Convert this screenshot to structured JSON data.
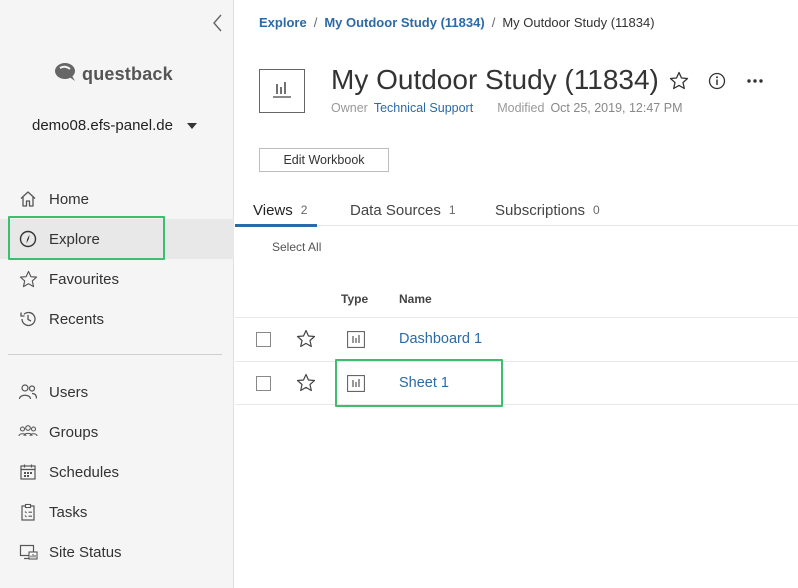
{
  "sidebar": {
    "logo_text": "questback",
    "site_name": "demo08.efs-panel.de",
    "nav_primary": [
      {
        "label": "Home",
        "icon": "home-icon"
      },
      {
        "label": "Explore",
        "icon": "compass-icon",
        "active": true
      },
      {
        "label": "Favourites",
        "icon": "star-icon"
      },
      {
        "label": "Recents",
        "icon": "history-icon"
      }
    ],
    "nav_admin": [
      {
        "label": "Users",
        "icon": "users-icon"
      },
      {
        "label": "Groups",
        "icon": "groups-icon"
      },
      {
        "label": "Schedules",
        "icon": "calendar-icon"
      },
      {
        "label": "Tasks",
        "icon": "clipboard-icon"
      },
      {
        "label": "Site Status",
        "icon": "site-status-icon"
      }
    ]
  },
  "breadcrumb": {
    "root": "Explore",
    "project": "My Outdoor Study (11834)",
    "current": "My Outdoor Study (11834)",
    "separator": "/"
  },
  "workbook": {
    "title": "My Outdoor Study (11834)",
    "owner_label": "Owner",
    "owner": "Technical Support",
    "modified_label": "Modified",
    "modified": "Oct 25, 2019, 12:47 PM",
    "edit_button": "Edit Workbook"
  },
  "tabs": [
    {
      "label": "Views",
      "count": "2",
      "active": true
    },
    {
      "label": "Data Sources",
      "count": "1"
    },
    {
      "label": "Subscriptions",
      "count": "0"
    }
  ],
  "table": {
    "select_all": "Select All",
    "col_type": "Type",
    "col_name": "Name",
    "rows": [
      {
        "name": "Dashboard 1",
        "type_icon": "bar-chart-icon"
      },
      {
        "name": "Sheet 1",
        "type_icon": "bar-chart-icon"
      }
    ]
  },
  "colors": {
    "link": "#2c6aa6",
    "highlight": "#3dbd6d",
    "sidebar_bg": "#f5f5f5"
  }
}
